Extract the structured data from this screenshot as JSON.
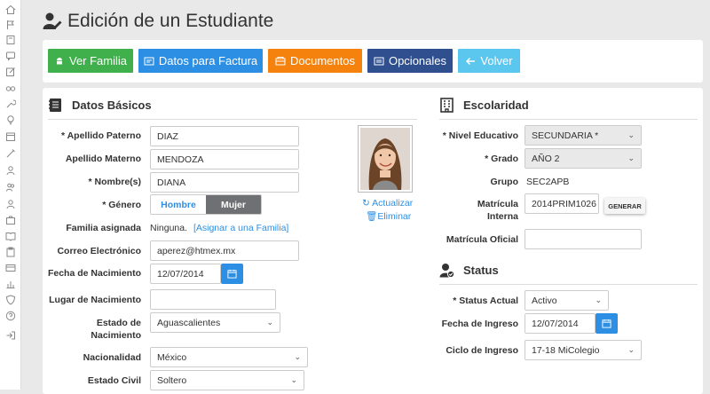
{
  "sidebar": {
    "icons": [
      "home-icon",
      "flag-icon",
      "book-icon",
      "chat-icon",
      "edit-icon",
      "glasses-icon",
      "wrench-icon",
      "bulb-icon",
      "calendar-icon",
      "tools-icon",
      "users-icon",
      "user-group-icon",
      "briefcase-icon",
      "book-open-icon",
      "clipboard-icon",
      "card-icon",
      "chart-icon",
      "shield-icon",
      "help-icon",
      "logout-icon"
    ]
  },
  "header": {
    "title": "Edición de un Estudiante"
  },
  "toolbar": {
    "ver_familia": "Ver Familia",
    "datos_factura": "Datos para Factura",
    "documentos": "Documentos",
    "opcionales": "Opcionales",
    "volver": "Volver"
  },
  "colors": {
    "green": "#3fb04b",
    "blue": "#2d8fe3",
    "orange": "#f5820d",
    "navy": "#2f4f8f",
    "lightblue": "#5bc7ef"
  },
  "datos": {
    "title": "Datos Básicos",
    "apellido_paterno_label": "* Apellido Paterno",
    "apellido_paterno": "DIAZ",
    "apellido_materno_label": "Apellido Materno",
    "apellido_materno": "MENDOZA",
    "nombres_label": "* Nombre(s)",
    "nombres": "DIANA",
    "genero_label": "* Género",
    "hombre": "Hombre",
    "mujer": "Mujer",
    "familia_label": "Familia asignada",
    "familia_value": "Ninguna.",
    "familia_link": "[Asignar a una Familia]",
    "correo_label": "Correo Electrónico",
    "correo": "aperez@htmex.mx",
    "fecha_nac_label": "Fecha de Nacimiento",
    "fecha_nac": "12/07/2014",
    "lugar_nac_label": "Lugar de Nacimiento",
    "lugar_nac": "",
    "estado_nac_label1": "Estado de",
    "estado_nac_label2": "Nacimiento",
    "estado_nac": "Aguascalientes",
    "nacionalidad_label": "Nacionalidad",
    "nacionalidad": "México",
    "estado_civil_label": "Estado Civil",
    "estado_civil": "Soltero",
    "actualizar": "Actualizar",
    "eliminar": "Eliminar"
  },
  "escolaridad": {
    "title": "Escolaridad",
    "nivel_label": "* Nivel Educativo",
    "nivel": "SECUNDARIA *",
    "grado_label": "* Grado",
    "grado": "AÑO 2",
    "grupo_label": "Grupo",
    "grupo": "SEC2APB",
    "matricula_label1": "Matrícula",
    "matricula_label2": "Interna",
    "matricula": "2014PRIM1026",
    "generar": "GENERAR",
    "matricula_oficial_label": "Matrícula Oficial",
    "matricula_oficial": ""
  },
  "status": {
    "title": "Status",
    "actual_label": "* Status Actual",
    "actual": "Activo",
    "fecha_ingreso_label": "Fecha de Ingreso",
    "fecha_ingreso": "12/07/2014",
    "ciclo_label": "Ciclo de Ingreso",
    "ciclo": "17-18 MiColegio"
  }
}
